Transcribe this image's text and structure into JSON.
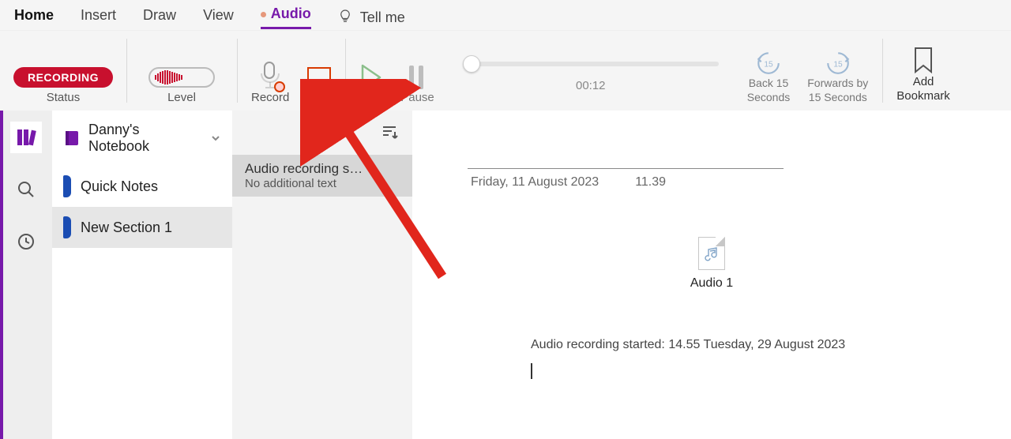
{
  "tabs": {
    "home": "Home",
    "insert": "Insert",
    "draw": "Draw",
    "view": "View",
    "audio": "Audio",
    "tellme": "Tell me"
  },
  "ribbon": {
    "status_pill": "RECORDING",
    "status_label": "Status",
    "level_label": "Level",
    "record": "Record",
    "stop": "Stop",
    "play": "Play",
    "pause": "Pause",
    "time": "00:12",
    "back15_l1": "Back 15",
    "back15_l2": "Seconds",
    "fwd15_l1": "Forwards by",
    "fwd15_l2": "15 Seconds",
    "bookmark_l1": "Add",
    "bookmark_l2": "Bookmark",
    "skip_value": "15"
  },
  "notebook": {
    "name": "Danny's Notebook",
    "sections": [
      {
        "label": "Quick Notes"
      },
      {
        "label": "New Section 1"
      }
    ]
  },
  "page_list": {
    "items": [
      {
        "title": "Audio recording s…",
        "subtitle": "No additional text"
      }
    ]
  },
  "page": {
    "date": "Friday, 11 August 2023",
    "time": "11.39",
    "audio_name": "Audio 1",
    "audio_started": "Audio recording started: 14.55 Tuesday, 29 August 2023"
  }
}
